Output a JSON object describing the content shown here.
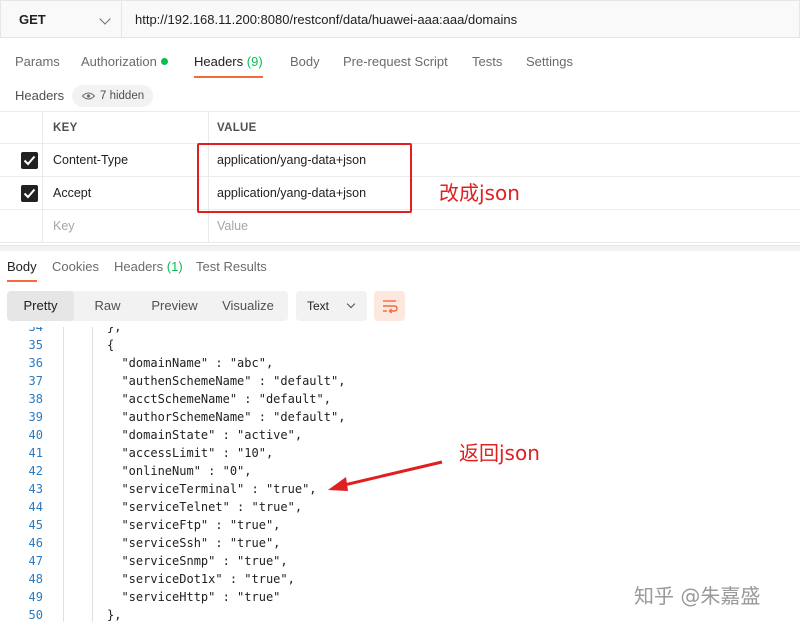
{
  "request": {
    "method": "GET",
    "url": "http://192.168.11.200:8080/restconf/data/huawei-aaa:aaa/domains"
  },
  "request_tabs": [
    {
      "label": "Params"
    },
    {
      "label": "Authorization"
    },
    {
      "label": "Headers",
      "count": "(9)"
    },
    {
      "label": "Body"
    },
    {
      "label": "Pre-request Script"
    },
    {
      "label": "Tests"
    },
    {
      "label": "Settings"
    }
  ],
  "headers_section": {
    "label": "Headers",
    "hidden": "7 hidden"
  },
  "headers_table": {
    "columns": [
      "KEY",
      "VALUE"
    ],
    "rows": [
      {
        "key": "Content-Type",
        "value": "application/yang-data+json",
        "checked": true
      },
      {
        "key": "Accept",
        "value": "application/yang-data+json",
        "checked": true
      }
    ],
    "placeholder_key": "Key",
    "placeholder_value": "Value"
  },
  "annotations": {
    "change_json": "改成json",
    "return_json": "返回json",
    "color": "#e02020"
  },
  "response_tabs": [
    {
      "label": "Body"
    },
    {
      "label": "Cookies"
    },
    {
      "label": "Headers",
      "count": "(1)"
    },
    {
      "label": "Test Results"
    }
  ],
  "view_modes": [
    "Pretty",
    "Raw",
    "Preview",
    "Visualize"
  ],
  "format_select": "Text",
  "code_lines": [
    {
      "n": "34",
      "text": "},"
    },
    {
      "n": "35",
      "text": "{"
    },
    {
      "n": "36",
      "text": "  \"domainName\" : \"abc\","
    },
    {
      "n": "37",
      "text": "  \"authenSchemeName\" : \"default\","
    },
    {
      "n": "38",
      "text": "  \"acctSchemeName\" : \"default\","
    },
    {
      "n": "39",
      "text": "  \"authorSchemeName\" : \"default\","
    },
    {
      "n": "40",
      "text": "  \"domainState\" : \"active\","
    },
    {
      "n": "41",
      "text": "  \"accessLimit\" : \"10\","
    },
    {
      "n": "42",
      "text": "  \"onlineNum\" : \"0\","
    },
    {
      "n": "43",
      "text": "  \"serviceTerminal\" : \"true\","
    },
    {
      "n": "44",
      "text": "  \"serviceTelnet\" : \"true\","
    },
    {
      "n": "45",
      "text": "  \"serviceFtp\" : \"true\","
    },
    {
      "n": "46",
      "text": "  \"serviceSsh\" : \"true\","
    },
    {
      "n": "47",
      "text": "  \"serviceSnmp\" : \"true\","
    },
    {
      "n": "48",
      "text": "  \"serviceDot1x\" : \"true\","
    },
    {
      "n": "49",
      "text": "  \"serviceHttp\" : \"true\""
    },
    {
      "n": "50",
      "text": "},"
    }
  ],
  "watermark": "知乎 @朱嘉盛",
  "colors": {
    "accent": "#f26b3a",
    "status_green": "#0cbb52",
    "line_number": "#2b7bc0"
  }
}
